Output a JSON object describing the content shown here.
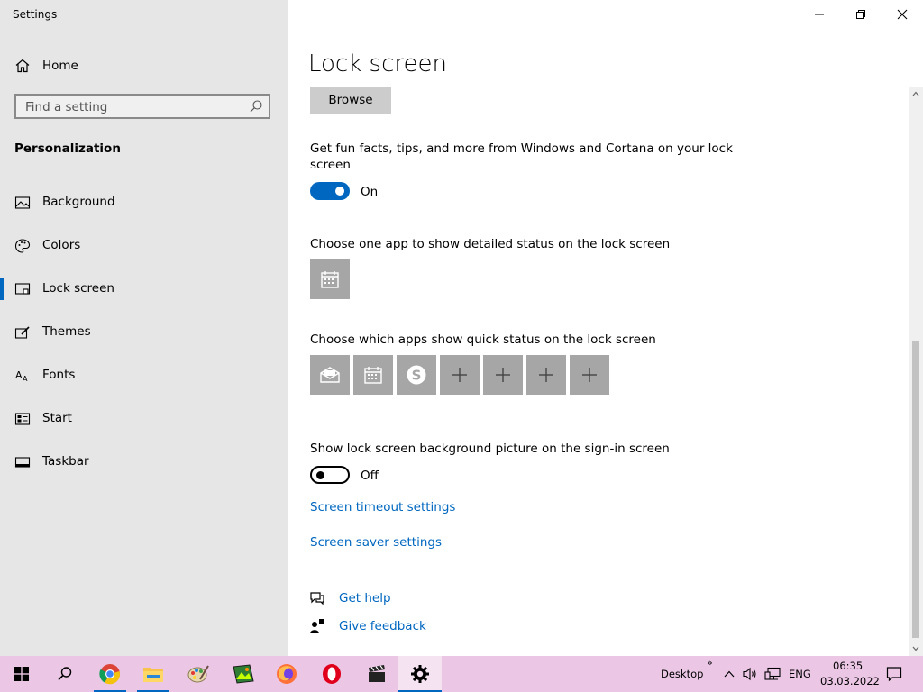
{
  "app": {
    "title": "Settings"
  },
  "sidebar": {
    "home_label": "Home",
    "search_placeholder": "Find a setting",
    "section_title": "Personalization",
    "items": [
      {
        "label": "Background",
        "icon": "picture-icon"
      },
      {
        "label": "Colors",
        "icon": "palette-icon"
      },
      {
        "label": "Lock screen",
        "icon": "lock-screen-icon",
        "active": true
      },
      {
        "label": "Themes",
        "icon": "brush-icon"
      },
      {
        "label": "Fonts",
        "icon": "font-icon"
      },
      {
        "label": "Start",
        "icon": "start-icon"
      },
      {
        "label": "Taskbar",
        "icon": "taskbar-icon"
      }
    ]
  },
  "main": {
    "title": "Lock screen",
    "browse_label": "Browse",
    "fun_facts": {
      "line1": "Get fun facts, tips, and more from Windows and Cortana on your lock",
      "line2": "screen",
      "state_label": "On"
    },
    "detailed_status": {
      "label": "Choose one app to show detailed status on the lock screen",
      "app_icon": "calendar-icon"
    },
    "quick_status": {
      "label": "Choose which apps show quick status on the lock screen",
      "apps": [
        "mail-icon",
        "calendar-icon",
        "skype-icon",
        "plus-icon",
        "plus-icon",
        "plus-icon",
        "plus-icon"
      ]
    },
    "signin_picture": {
      "label": "Show lock screen background picture on the sign-in screen",
      "state_label": "Off"
    },
    "links": {
      "timeout": "Screen timeout settings",
      "saver": "Screen saver settings"
    },
    "help": {
      "get_help": "Get help",
      "feedback": "Give feedback"
    }
  },
  "taskbar": {
    "desktop_label": "Desktop",
    "chevron": "»",
    "language": "ENG",
    "time": "06:35",
    "date": "03.03.2022"
  },
  "colors": {
    "accent": "#0067c0",
    "sidebar_bg": "#e6e6e6",
    "taskbar_bg": "#ebc7e5",
    "tile_bg": "#a6a6a6"
  }
}
